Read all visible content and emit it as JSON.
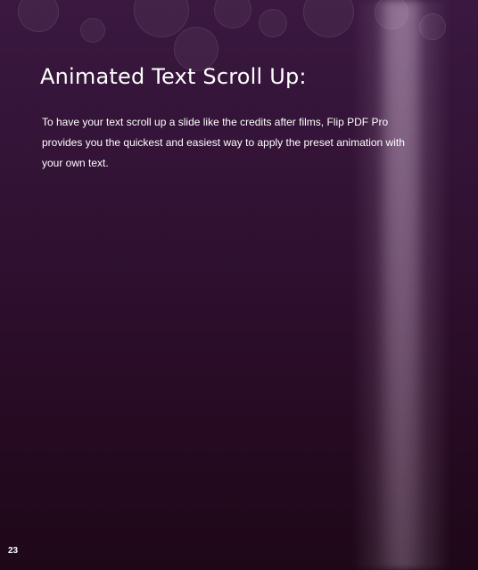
{
  "page": {
    "title": "Animated Text Scroll Up:",
    "body": "To have your text scroll up a slide like the credits after films, Flip PDF Pro provides you the quickest and easiest way to apply the preset animation with your own text.",
    "page_number": "23"
  },
  "colors": {
    "background": "#2f1030",
    "text": "#ffffff"
  }
}
